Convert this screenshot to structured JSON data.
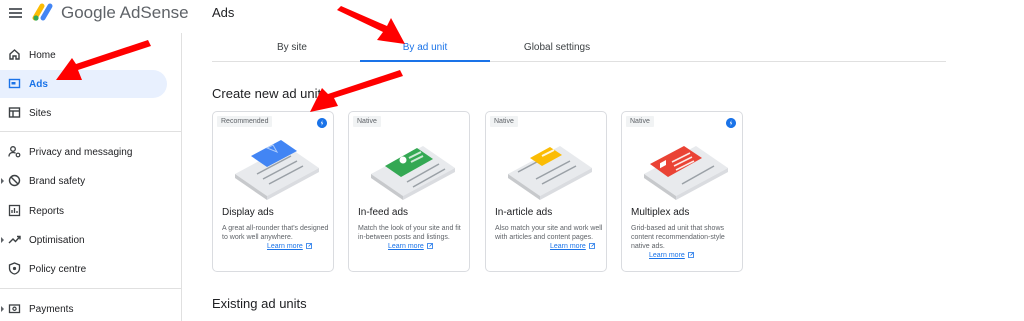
{
  "header": {
    "app_name": "Google AdSense",
    "page_title": "Ads"
  },
  "sidebar": {
    "items": [
      {
        "label": "Home",
        "icon": "home-icon",
        "active": false
      },
      {
        "label": "Ads",
        "icon": "ads-icon",
        "active": true
      },
      {
        "label": "Sites",
        "icon": "sites-icon",
        "active": false
      },
      {
        "label": "Privacy and messaging",
        "icon": "privacy-icon",
        "active": false
      },
      {
        "label": "Brand safety",
        "icon": "block-icon",
        "active": false
      },
      {
        "label": "Reports",
        "icon": "reports-icon",
        "active": false
      },
      {
        "label": "Optimisation",
        "icon": "trending-icon",
        "active": false
      },
      {
        "label": "Policy centre",
        "icon": "shield-icon",
        "active": false
      },
      {
        "label": "Payments",
        "icon": "payments-icon",
        "active": false
      }
    ]
  },
  "tabs": [
    {
      "label": "By site",
      "active": false
    },
    {
      "label": "By ad unit",
      "active": true
    },
    {
      "label": "Global settings",
      "active": false
    }
  ],
  "create_section": {
    "title": "Create new ad unit",
    "cards": [
      {
        "badge": "Recommended",
        "title": "Display ads",
        "desc": "A great all-rounder that's designed to work well anywhere.",
        "link": "Learn more",
        "accent": "#4285f4"
      },
      {
        "badge": "Native",
        "title": "In-feed ads",
        "desc": "Match the look of your site and fit in-between posts and listings.",
        "link": "Learn more",
        "accent": "#34a853"
      },
      {
        "badge": "Native",
        "title": "In-article ads",
        "desc": "Also match your site and work well with articles and content pages.",
        "link": "Learn more",
        "accent": "#fbbc04"
      },
      {
        "badge": "Native",
        "title": "Multiplex ads",
        "desc": "Grid-based ad unit that shows content recommendation-style native ads.",
        "link": "Learn more",
        "accent": "#ea4335"
      }
    ]
  },
  "existing_section": {
    "title": "Existing ad units"
  },
  "colors": {
    "accent": "#1a73e8",
    "arrow": "#ff0000"
  }
}
